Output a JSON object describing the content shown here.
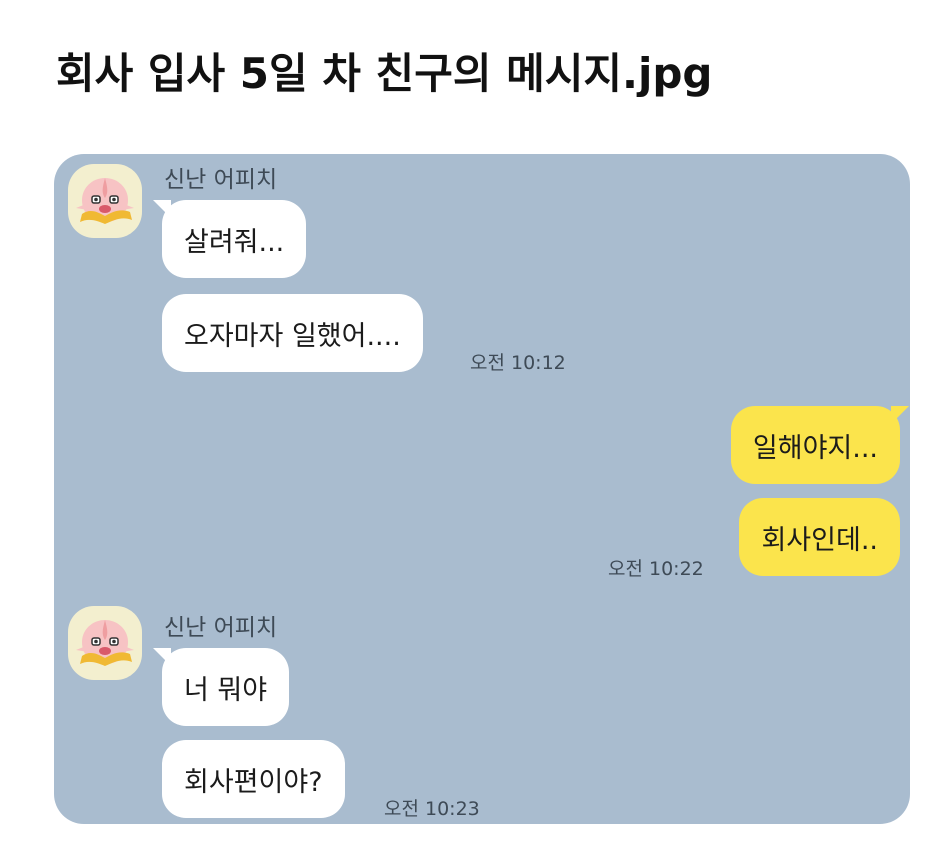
{
  "page_title": "회사 입사 5일 차 친구의 메시지.jpg",
  "colors": {
    "chat_background": "#a9bccf",
    "incoming_bubble": "#ffffff",
    "outgoing_bubble": "#fbe44c",
    "avatar_background": "#f3efcf"
  },
  "groups": [
    {
      "sender": "신난 어피치",
      "avatar_icon": "apeach-character-icon",
      "messages": [
        "살려줘...",
        "오자마자 일했어...."
      ],
      "time": "오전 10:12"
    },
    {
      "sender": "me",
      "messages": [
        "일해야지...",
        "회사인데.."
      ],
      "time": "오전 10:22"
    },
    {
      "sender": "신난 어피치",
      "avatar_icon": "apeach-character-icon",
      "messages": [
        "너 뭐야",
        "회사편이야?"
      ],
      "time": "오전 10:23"
    }
  ]
}
